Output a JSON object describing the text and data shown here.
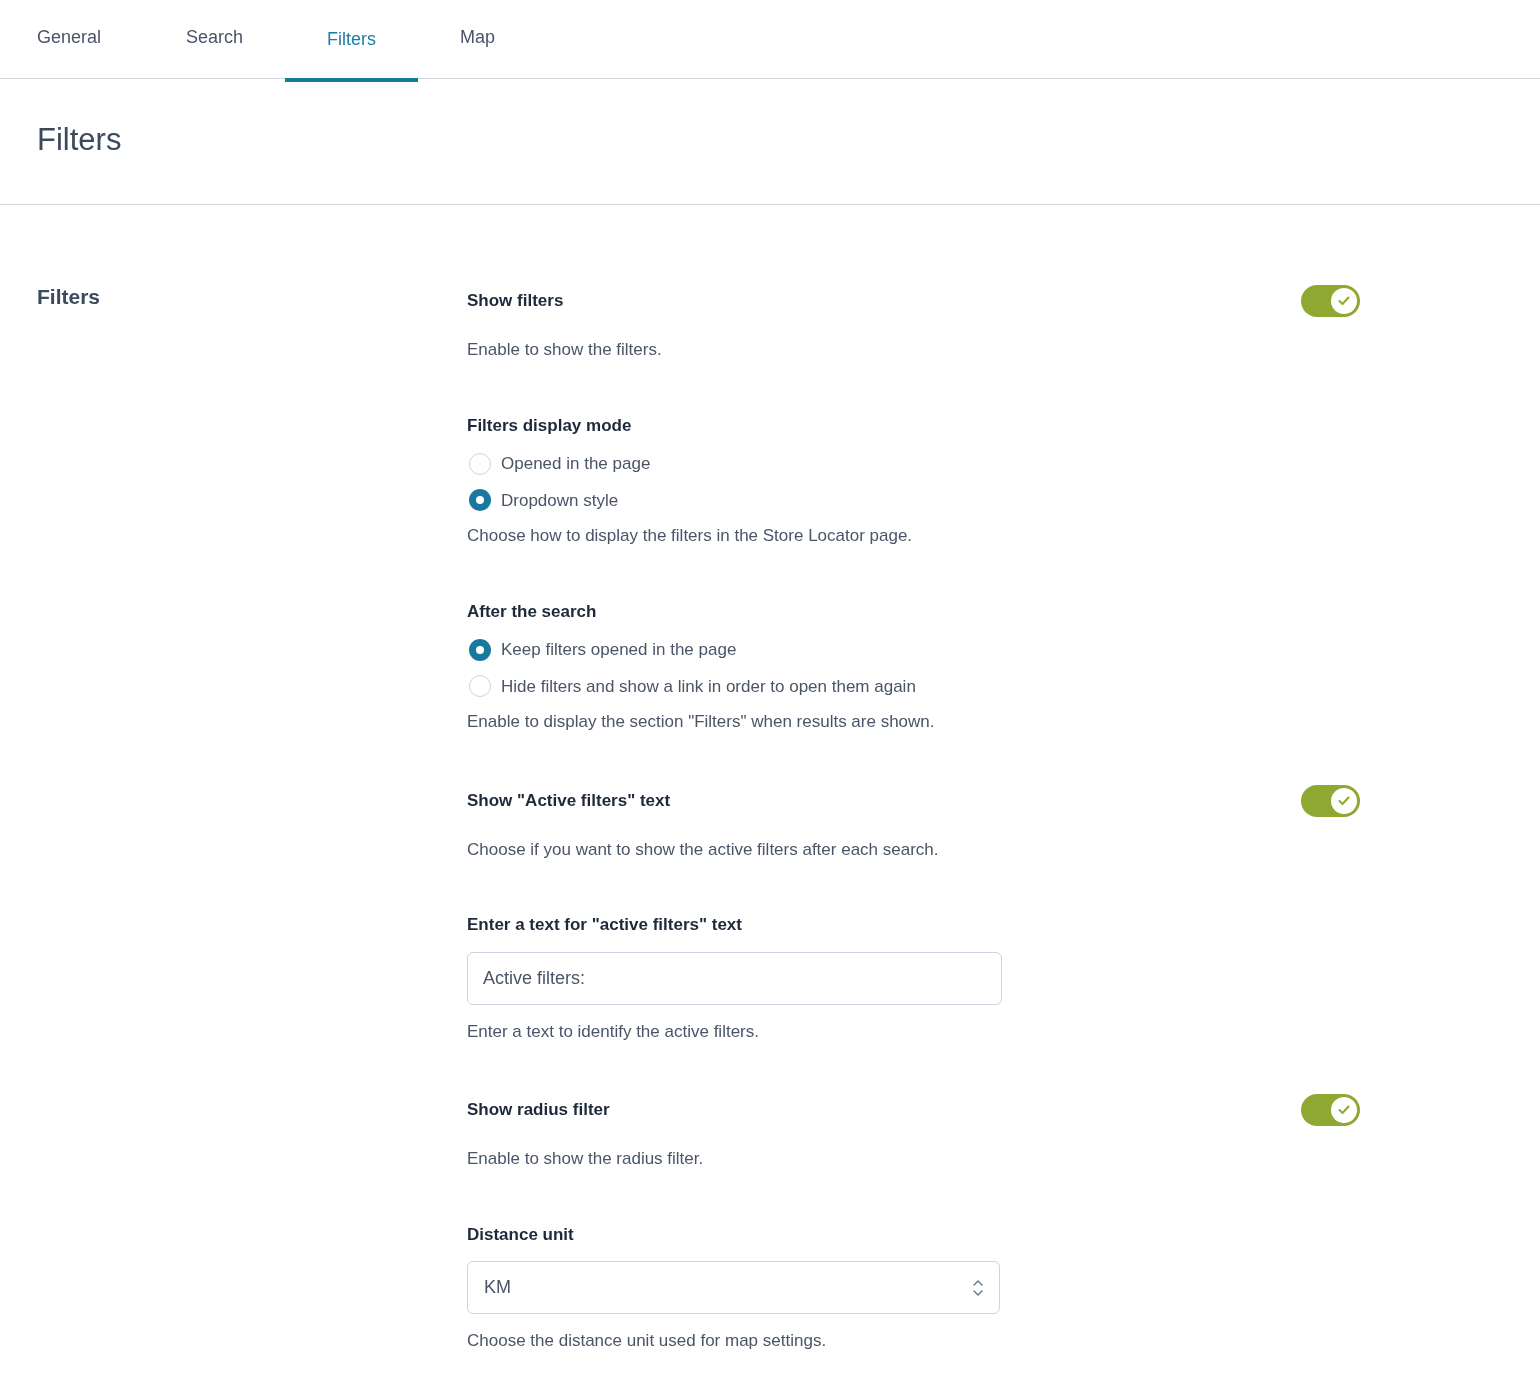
{
  "tabs": [
    {
      "label": "General",
      "selected": false
    },
    {
      "label": "Search",
      "selected": false
    },
    {
      "label": "Filters",
      "selected": true
    },
    {
      "label": "Map",
      "selected": false
    }
  ],
  "page_title": "Filters",
  "section": {
    "title": "Filters",
    "fields": [
      {
        "kind": "toggle",
        "label": "Show filters",
        "on": true,
        "description": "Enable to show the filters."
      },
      {
        "kind": "radio",
        "label": "Filters display mode",
        "options": [
          {
            "label": "Opened in the page",
            "selected": false
          },
          {
            "label": "Dropdown style",
            "selected": true
          }
        ],
        "description": "Choose how to display the filters in the Store Locator page."
      },
      {
        "kind": "radio",
        "label": "After the search",
        "options": [
          {
            "label": "Keep filters opened in the page",
            "selected": true
          },
          {
            "label": "Hide filters and show a link in order to open them again",
            "selected": false
          }
        ],
        "description": "Enable to display the section \"Filters\" when results are shown."
      },
      {
        "kind": "toggle",
        "label": "Show \"Active filters\" text",
        "on": true,
        "description": "Choose if you want to show the active filters after each search."
      },
      {
        "kind": "text",
        "label": "Enter a text for \"active filters\" text",
        "value": "Active filters:",
        "description": "Enter a text to identify the active filters."
      },
      {
        "kind": "toggle",
        "label": "Show radius filter",
        "on": true,
        "description": "Enable to show the radius filter."
      },
      {
        "kind": "select",
        "label": "Distance unit",
        "value": "KM",
        "description": "Choose the distance unit used for map settings."
      }
    ]
  }
}
